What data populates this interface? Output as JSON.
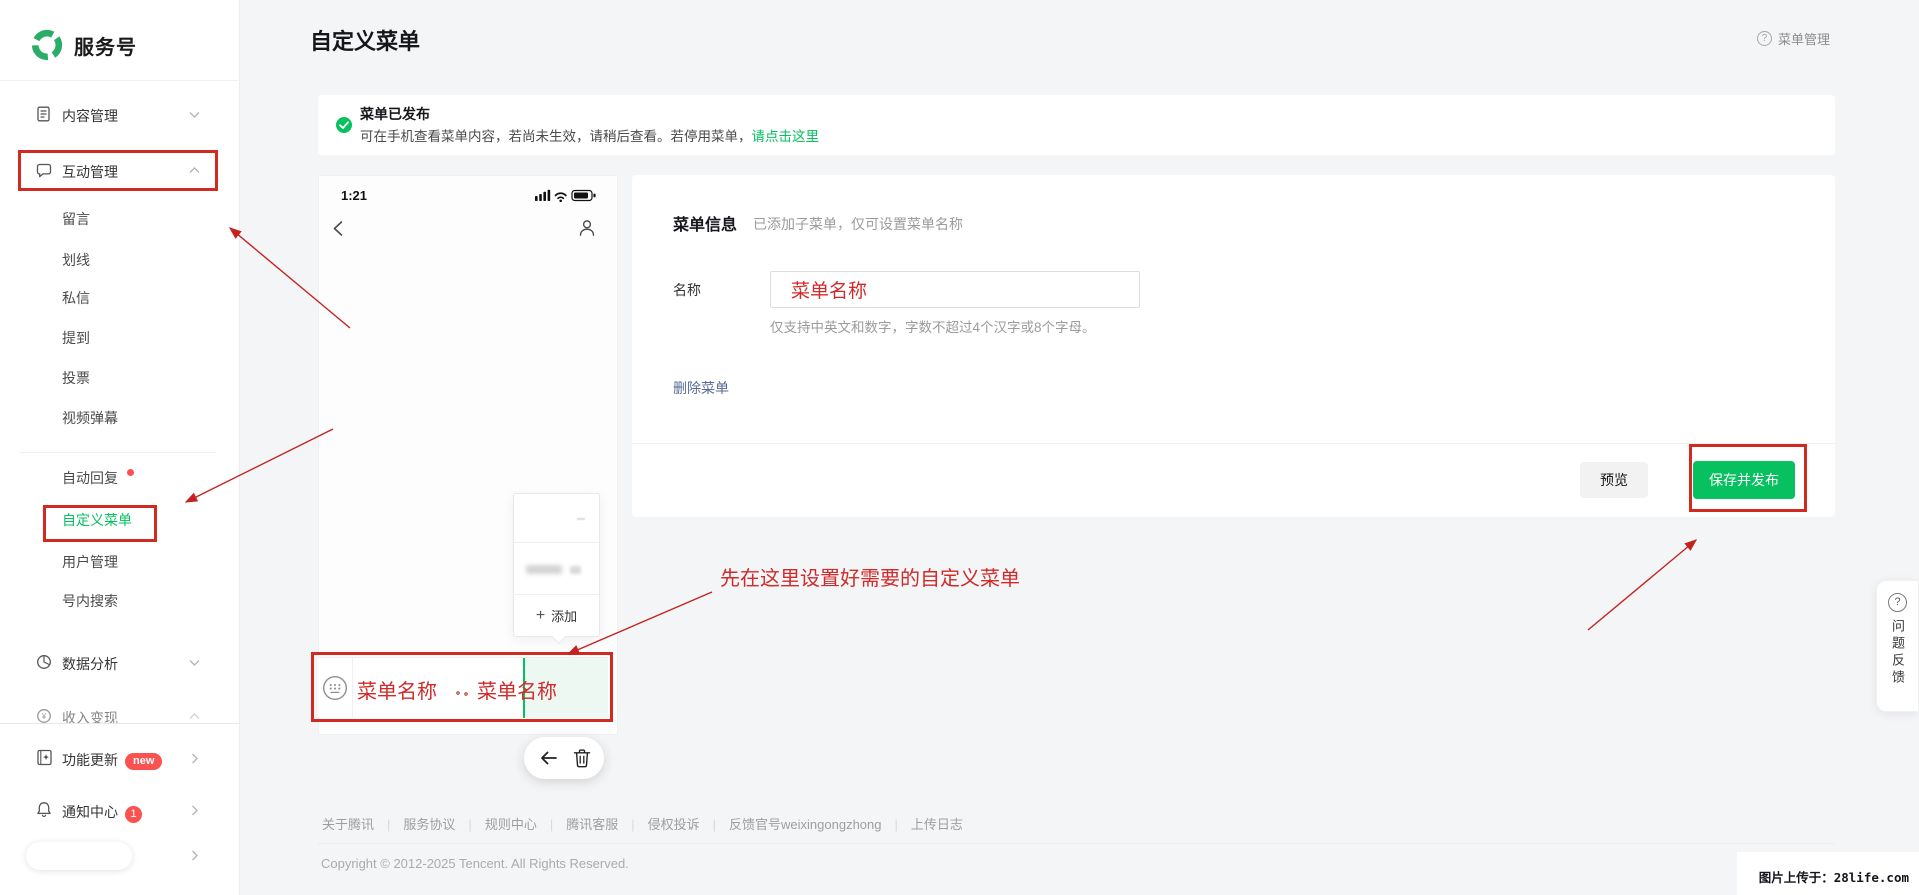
{
  "icons": {
    "question_mark": "?",
    "plus": "+",
    "yen": "¥"
  },
  "sidebar": {
    "brand": "服务号",
    "groups": {
      "content": "内容管理",
      "interact": "互动管理",
      "analysis": "数据分析",
      "revenue": "收入变现"
    },
    "interact_children": [
      "留言",
      "划线",
      "私信",
      "提到",
      "投票",
      "视频弹幕"
    ],
    "tools": [
      {
        "label": "自动回复"
      },
      {
        "label": "自定义菜单"
      },
      {
        "label": "用户管理"
      },
      {
        "label": "号内搜索"
      }
    ],
    "footer_items": [
      {
        "label": "功能更新",
        "badge": "new"
      },
      {
        "label": "通知中心",
        "badge": "1"
      }
    ]
  },
  "header": {
    "title": "自定义菜单",
    "menu_manage": "菜单管理"
  },
  "banner": {
    "title": "菜单已发布",
    "desc": "可在手机查看菜单内容，若尚未生效，请稍后查看。若停用菜单，",
    "link": "请点击这里"
  },
  "phone": {
    "time": "1:21",
    "add_label": "添加",
    "menu_left": "菜单名称",
    "menu_right": "菜单名称"
  },
  "form": {
    "section_title": "菜单信息",
    "section_hint": "已添加子菜单，仅可设置菜单名称",
    "name_label": "名称",
    "name_value": "菜单名称",
    "name_help": "仅支持中英文和数字，字数不超过4个汉字或8个字母。",
    "delete_link": "删除菜单",
    "preview_btn": "预览",
    "save_btn": "保存并发布"
  },
  "annotations": {
    "tip": "先在这里设置好需要的自定义菜单"
  },
  "footer": {
    "separator": "|",
    "links": [
      "关于腾讯",
      "服务协议",
      "规则中心",
      "腾讯客服",
      "侵权投诉",
      "反馈官号weixingongzhong",
      "上传日志"
    ],
    "copyright": "Copyright © 2012-2025 Tencent. All Rights Reserved."
  },
  "floating": {
    "feedback": "问题反馈"
  },
  "watermark": "图片上传于：28life.com",
  "colors": {
    "brand_green": "#07c160",
    "annotation_red": "#d02a21",
    "badge_red": "#fa5151",
    "delete_link_blue": "#576b95"
  }
}
